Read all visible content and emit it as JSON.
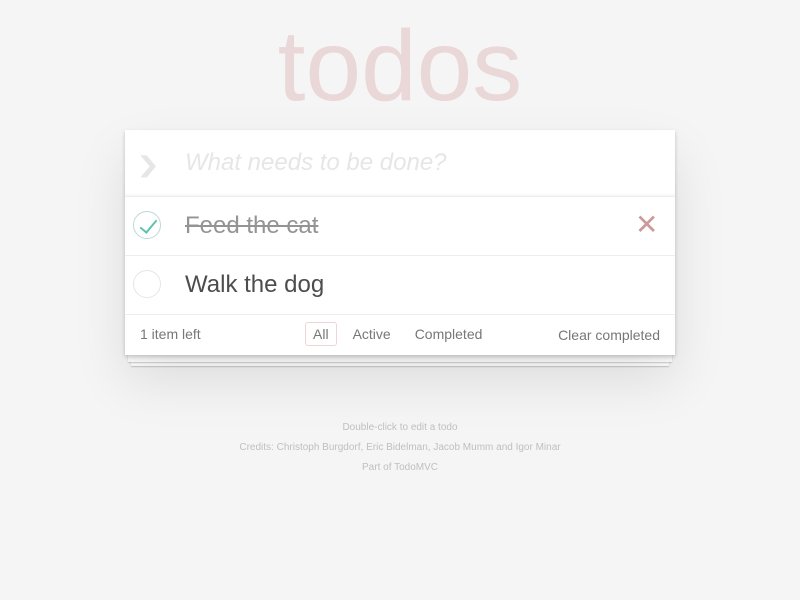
{
  "app_title": "todos",
  "new_todo": {
    "placeholder": "What needs to be done?"
  },
  "toggle_all_icon": "chevron-down-icon",
  "todos": [
    {
      "label": "Feed the cat",
      "completed": true
    },
    {
      "label": "Walk the dog",
      "completed": false
    }
  ],
  "footer": {
    "count_text": "1 item left",
    "filters": [
      {
        "label": "All",
        "selected": true
      },
      {
        "label": "Active",
        "selected": false
      },
      {
        "label": "Completed",
        "selected": false
      }
    ],
    "clear_label": "Clear completed"
  },
  "info": {
    "line1": "Double-click to edit a todo",
    "line2": "Credits: Christoph Burgdorf, Eric Bidelman, Jacob Mumm and Igor Minar",
    "line3": "Part of TodoMVC"
  },
  "colors": {
    "background": "#f5f5f5",
    "title": "#eaa8a8",
    "check_mark": "#5dc2af",
    "destroy": "#cc9a9a"
  }
}
